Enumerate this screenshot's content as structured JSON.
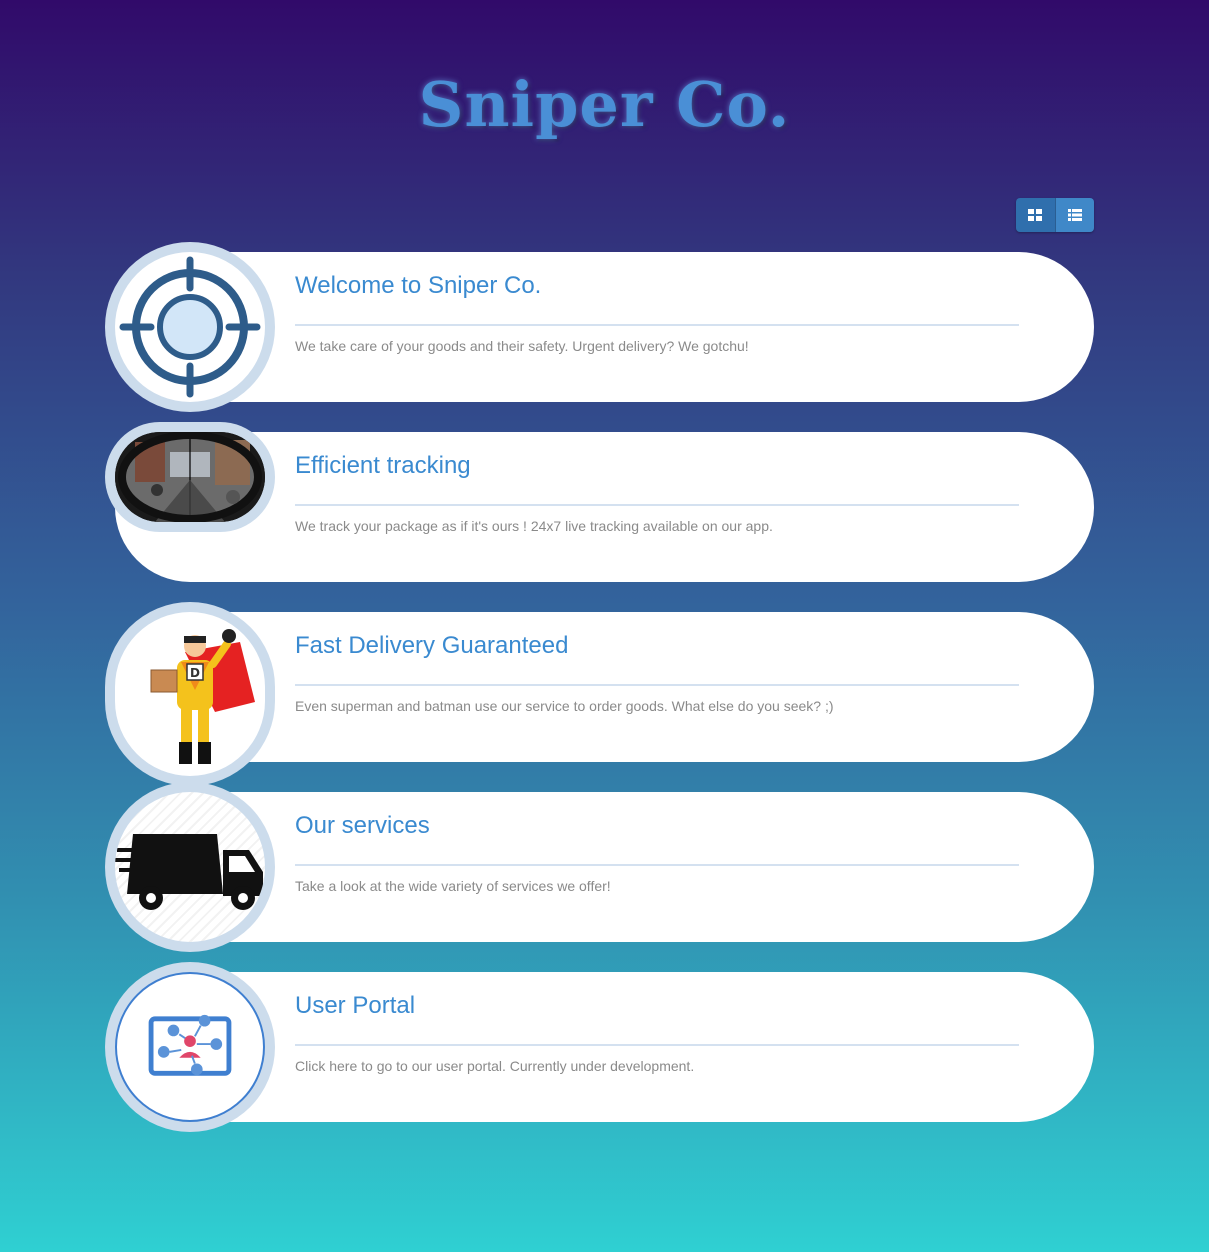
{
  "site": {
    "title": "Sniper Co."
  },
  "view_toggle": {
    "grid_icon": "grid-icon",
    "list_icon": "list-icon"
  },
  "cards": [
    {
      "title": "Welcome to Sniper Co.",
      "text": "We take care of your goods and their safety. Urgent delivery? We gotchu!",
      "icon": "crosshair-icon"
    },
    {
      "title": "Efficient tracking",
      "text": "We track your package as if it's ours ! 24x7 live tracking available on our app.",
      "icon": "scope-view-image"
    },
    {
      "title": "Fast Delivery Guaranteed",
      "text": "Even superman and batman use our service to order goods. What else do you seek? ;)",
      "icon": "superhero-delivery-image"
    },
    {
      "title": "Our services",
      "text": "Take a look at the wide variety of services we offer!",
      "icon": "delivery-truck-icon"
    },
    {
      "title": "User Portal",
      "text": "Click here to go to our user portal. Currently under development.",
      "icon": "user-portal-icon"
    }
  ],
  "colors": {
    "title": "#3a8ad0",
    "accent": "#3f88c8",
    "avatar_ring": "#ccdcec"
  }
}
